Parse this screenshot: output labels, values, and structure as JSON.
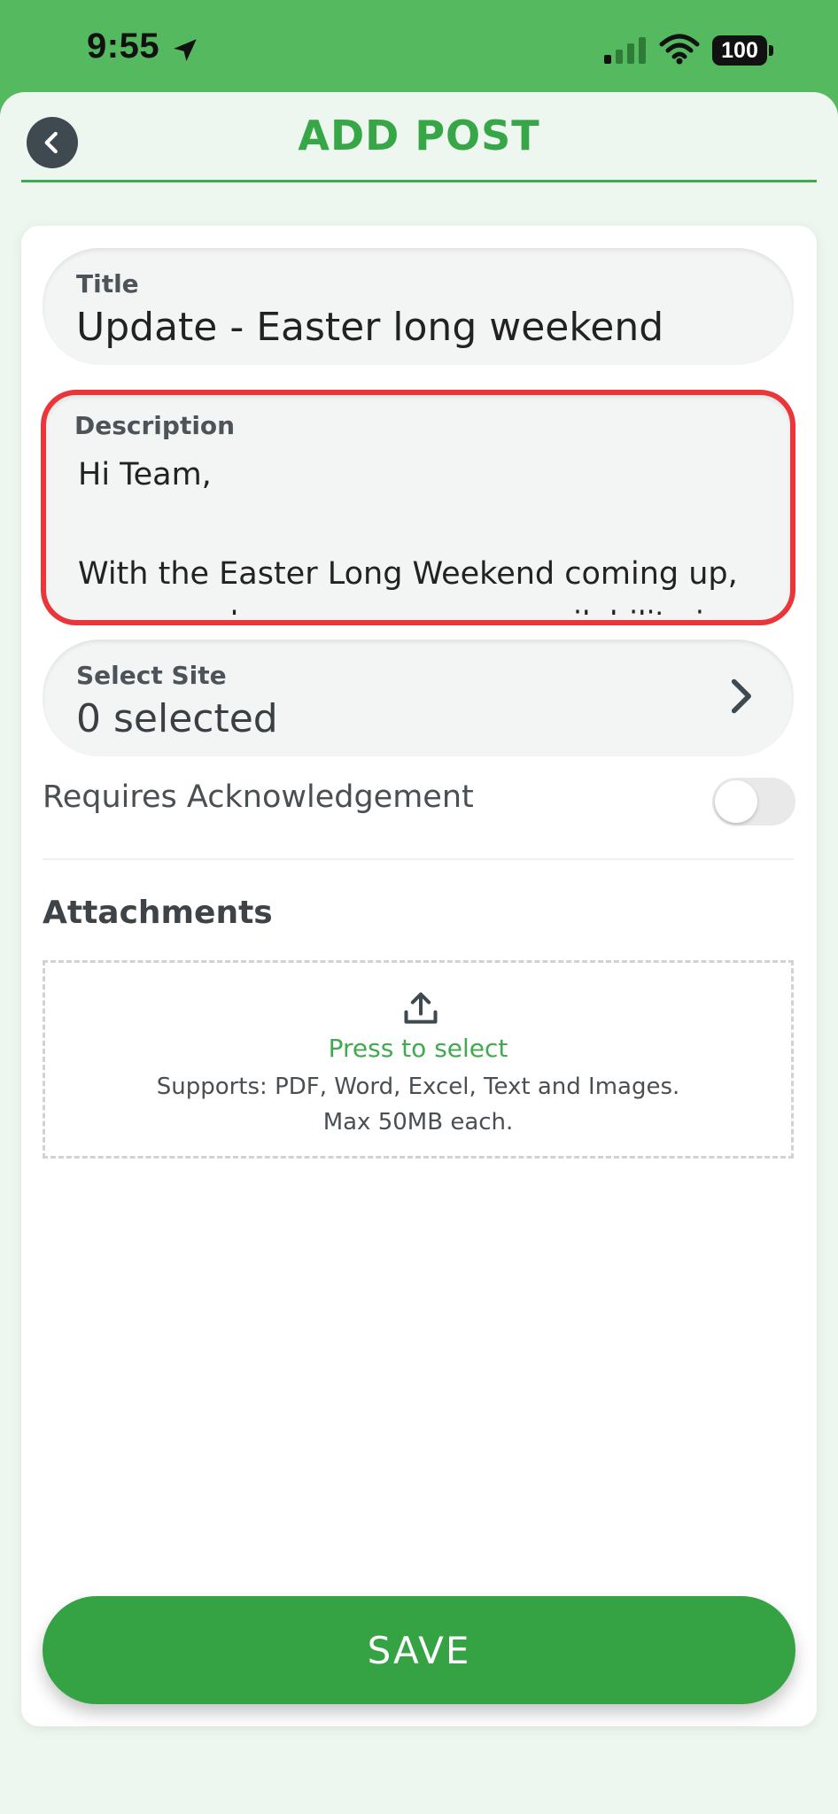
{
  "status_bar": {
    "time": "9:55",
    "battery": "100",
    "icons": [
      "location-arrow-icon",
      "cellular-signal-icon",
      "wifi-icon",
      "battery-icon"
    ]
  },
  "header": {
    "title": "ADD POST",
    "back_icon": "chevron-left-icon"
  },
  "form": {
    "title_field": {
      "label": "Title",
      "value": "Update - Easter long weekend"
    },
    "description_field": {
      "label": "Description",
      "lines": [
        "Hi Team,",
        "",
        "With the Easter Long Weekend coming up,",
        "can you please ensure your availability is"
      ]
    },
    "site_field": {
      "label": "Select Site",
      "value": "0 selected",
      "icon": "chevron-right-icon"
    },
    "acknowledgement": {
      "label": "Requires Acknowledgement",
      "enabled": false
    },
    "attachments": {
      "heading": "Attachments",
      "icon": "upload-icon",
      "action_text": "Press to select",
      "support_line_1": "Supports: PDF, Word, Excel, Text and Images.",
      "support_line_2": "Max 50MB each."
    }
  },
  "save_button": {
    "label": "SAVE"
  },
  "colors": {
    "brand_green": "#35a344",
    "status_bar_green": "#55b960",
    "highlight_red": "#e8363b",
    "background": "#eef7ef"
  }
}
